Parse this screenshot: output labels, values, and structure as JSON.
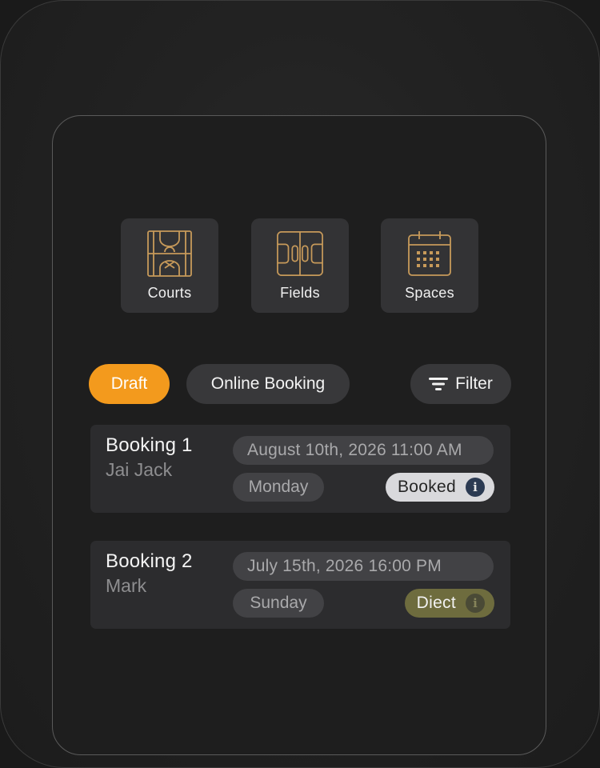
{
  "categories": {
    "courts": {
      "label": "Courts",
      "icon": "basketball-court-icon"
    },
    "fields": {
      "label": "Fields",
      "icon": "soccer-field-icon"
    },
    "spaces": {
      "label": "Spaces",
      "icon": "calendar-icon"
    }
  },
  "filters": {
    "draft": "Draft",
    "online_booking": "Online Booking",
    "filter": "Filter",
    "filter_icon": "filter-icon"
  },
  "bookings": [
    {
      "title": "Booking 1",
      "person": "Jai Jack",
      "datetime": "August 10th, 2026 11:00 AM",
      "day": "Monday",
      "status": "Booked"
    },
    {
      "title": "Booking 2",
      "person": "Mark",
      "datetime": "July 15th, 2026 16:00 PM",
      "day": "Sunday",
      "status": "Diect"
    }
  ],
  "colors": {
    "accent": "#f39a1d",
    "icon_gold": "#c79a5a",
    "card_bg": "#2c2c2e",
    "status_booked_bg": "#d9d9dc",
    "status_direct_bg": "#6e6c3e"
  }
}
